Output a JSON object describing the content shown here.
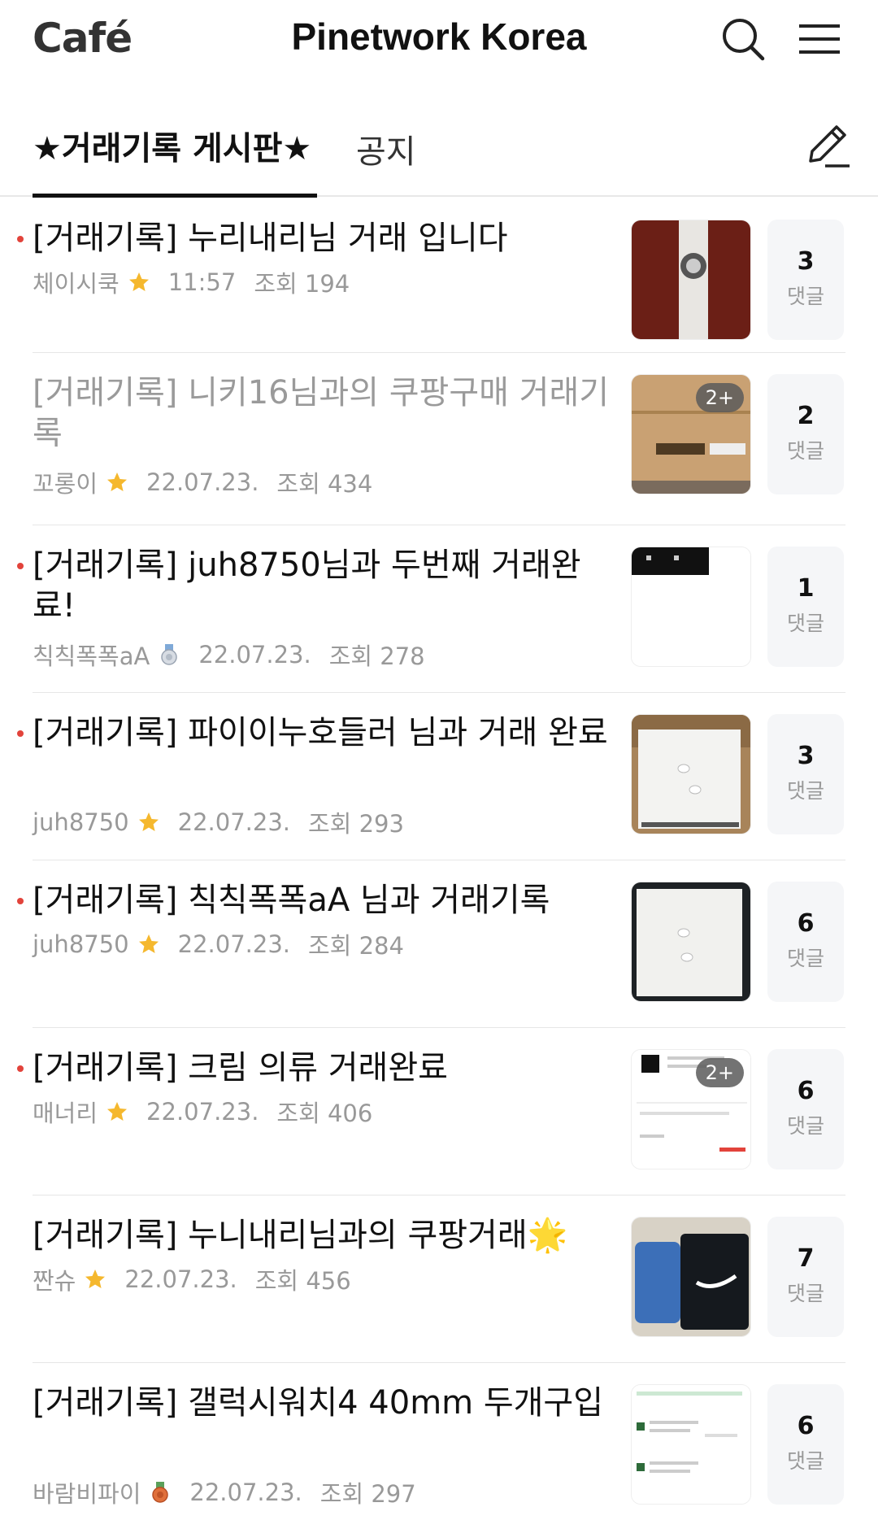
{
  "header": {
    "logo": "Café",
    "cafe_name": "Pinetwork Korea"
  },
  "tabs": [
    {
      "label": "★거래기록 게시판★",
      "active": true
    },
    {
      "label": "공지",
      "active": false
    }
  ],
  "posts": [
    {
      "title": "[거래기록] 누리내리님 거래 입니다",
      "author": "체이시쿡",
      "badge": "star-icon",
      "date": "11:57",
      "views": "조회 194",
      "comments": "3",
      "comment_label": "댓글",
      "new": true,
      "read": false,
      "thumb": "watch-box",
      "more": ""
    },
    {
      "title": "[거래기록] 니키16님과의 쿠팡구매 거래기록",
      "author": "꼬롱이",
      "badge": "star-icon",
      "date": "22.07.23.",
      "views": "조회 434",
      "comments": "2",
      "comment_label": "댓글",
      "new": false,
      "read": true,
      "thumb": "cardboard-box",
      "more": "2+"
    },
    {
      "title": "[거래기록] juh8750님과 두번째 거래완료!",
      "author": "칙칙폭폭aA",
      "badge": "medal-icon",
      "date": "22.07.23.",
      "views": "조회 278",
      "comments": "1",
      "comment_label": "댓글",
      "new": true,
      "read": false,
      "thumb": "screenshot",
      "more": ""
    },
    {
      "title": "[거래기록] 파이이누호들러 님과 거래 완료",
      "author": "juh8750",
      "badge": "star-icon",
      "date": "22.07.23.",
      "views": "조회 293",
      "comments": "3",
      "comment_label": "댓글",
      "new": true,
      "read": false,
      "thumb": "earbuds-box",
      "more": ""
    },
    {
      "title": "[거래기록] 칙칙폭폭aA 님과 거래기록",
      "author": "juh8750",
      "badge": "star-icon",
      "date": "22.07.23.",
      "views": "조회 284",
      "comments": "6",
      "comment_label": "댓글",
      "new": true,
      "read": false,
      "thumb": "earbuds-box-dark",
      "more": ""
    },
    {
      "title": "[거래기록] 크림 의류 거래완료",
      "author": "매너리",
      "badge": "star-icon",
      "date": "22.07.23.",
      "views": "조회 406",
      "comments": "6",
      "comment_label": "댓글",
      "new": true,
      "read": false,
      "thumb": "receipt",
      "more": "2+"
    },
    {
      "title": "[거래기록] 누니내리님과의 쿠팡거래🌟",
      "author": "짠슈",
      "badge": "star-icon",
      "date": "22.07.23.",
      "views": "조회 456",
      "comments": "7",
      "comment_label": "댓글",
      "new": false,
      "read": false,
      "thumb": "clothing",
      "more": ""
    },
    {
      "title": "[거래기록] 갤럭시워치4 40mm 두개구입",
      "author": "바람비파이",
      "badge": "medal-red-icon",
      "date": "22.07.23.",
      "views": "조회 297",
      "comments": "6",
      "comment_label": "댓글",
      "new": false,
      "read": false,
      "thumb": "order-list",
      "more": ""
    }
  ],
  "colors": {
    "accent": "#03c75a",
    "bullet": "#e2433b",
    "star": "#f5b82e"
  }
}
